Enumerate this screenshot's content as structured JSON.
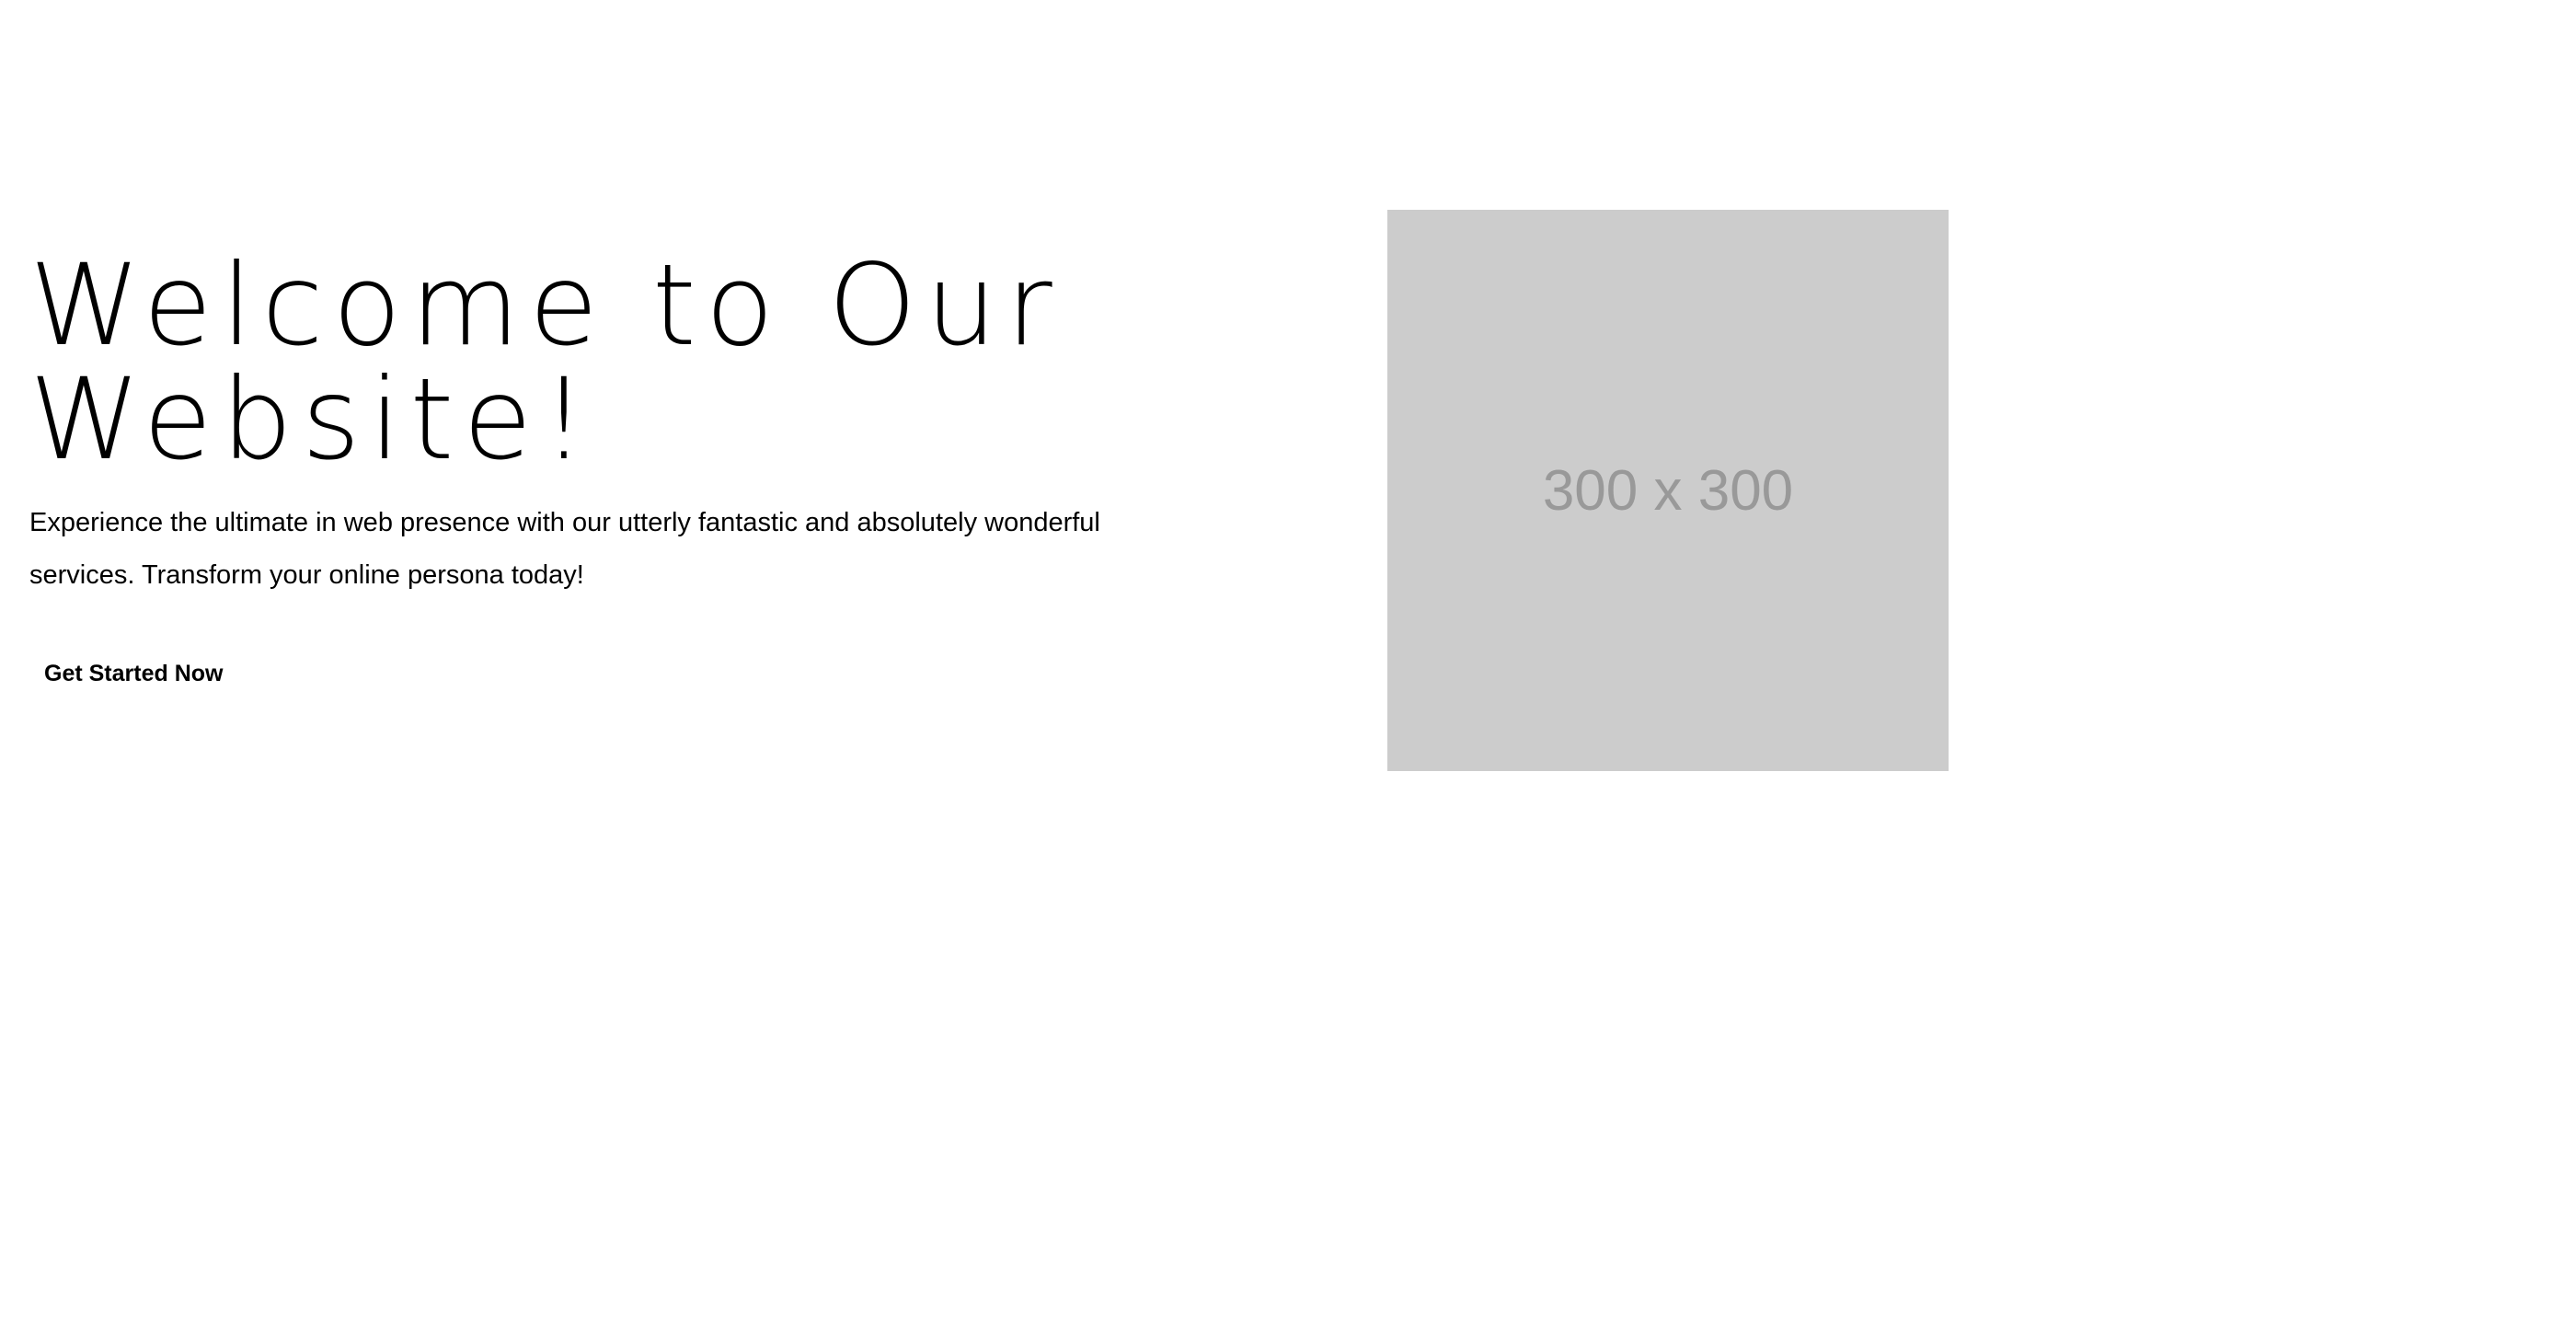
{
  "hero": {
    "title_line_1": "Welcome to Our",
    "title_line_2": "Website!",
    "subtitle": "Experience the ultimate in web presence with our utterly fantastic and absolutely wonderful services. Transform your online persona today!",
    "cta_label": "Get Started Now"
  },
  "image": {
    "placeholder_label": "300 x 300"
  },
  "colors": {
    "background": "#ffffff",
    "text": "#000000",
    "placeholder_bg": "#cccccc",
    "placeholder_text": "#999999"
  }
}
